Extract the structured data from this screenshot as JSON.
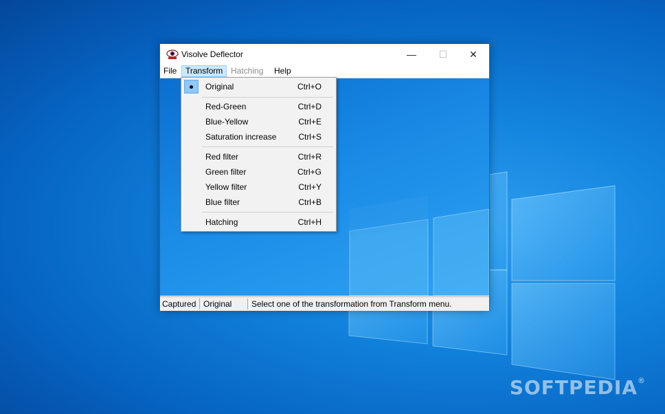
{
  "window": {
    "title": "Visolve Deflector",
    "minimize_glyph": "—",
    "maximize_glyph": "☐",
    "close_glyph": "✕"
  },
  "menubar": {
    "file": "File",
    "transform": "Transform",
    "hatching": "Hatching",
    "help": "Help"
  },
  "transform_menu": {
    "items": [
      {
        "label": "Original",
        "shortcut": "Ctrl+O",
        "checked": true
      },
      {
        "label": "Red-Green",
        "shortcut": "Ctrl+D"
      },
      {
        "label": "Blue-Yellow",
        "shortcut": "Ctrl+E"
      },
      {
        "label": "Saturation increase",
        "shortcut": "Ctrl+S"
      },
      {
        "label": "Red filter",
        "shortcut": "Ctrl+R"
      },
      {
        "label": "Green filter",
        "shortcut": "Ctrl+G"
      },
      {
        "label": "Yellow filter",
        "shortcut": "Ctrl+Y"
      },
      {
        "label": "Blue filter",
        "shortcut": "Ctrl+B"
      },
      {
        "label": "Hatching",
        "shortcut": "Ctrl+H"
      }
    ]
  },
  "statusbar": {
    "captured": "Captured",
    "mode": "Original",
    "message": "Select one of the transformation from Transform menu."
  },
  "watermark": {
    "text": "SOFTPEDIA",
    "mark": "®"
  },
  "colors": {
    "menu_highlight": "#cce8ff",
    "check_highlight": "#90c8f6",
    "desktop_blue": "#0a6fd0"
  }
}
